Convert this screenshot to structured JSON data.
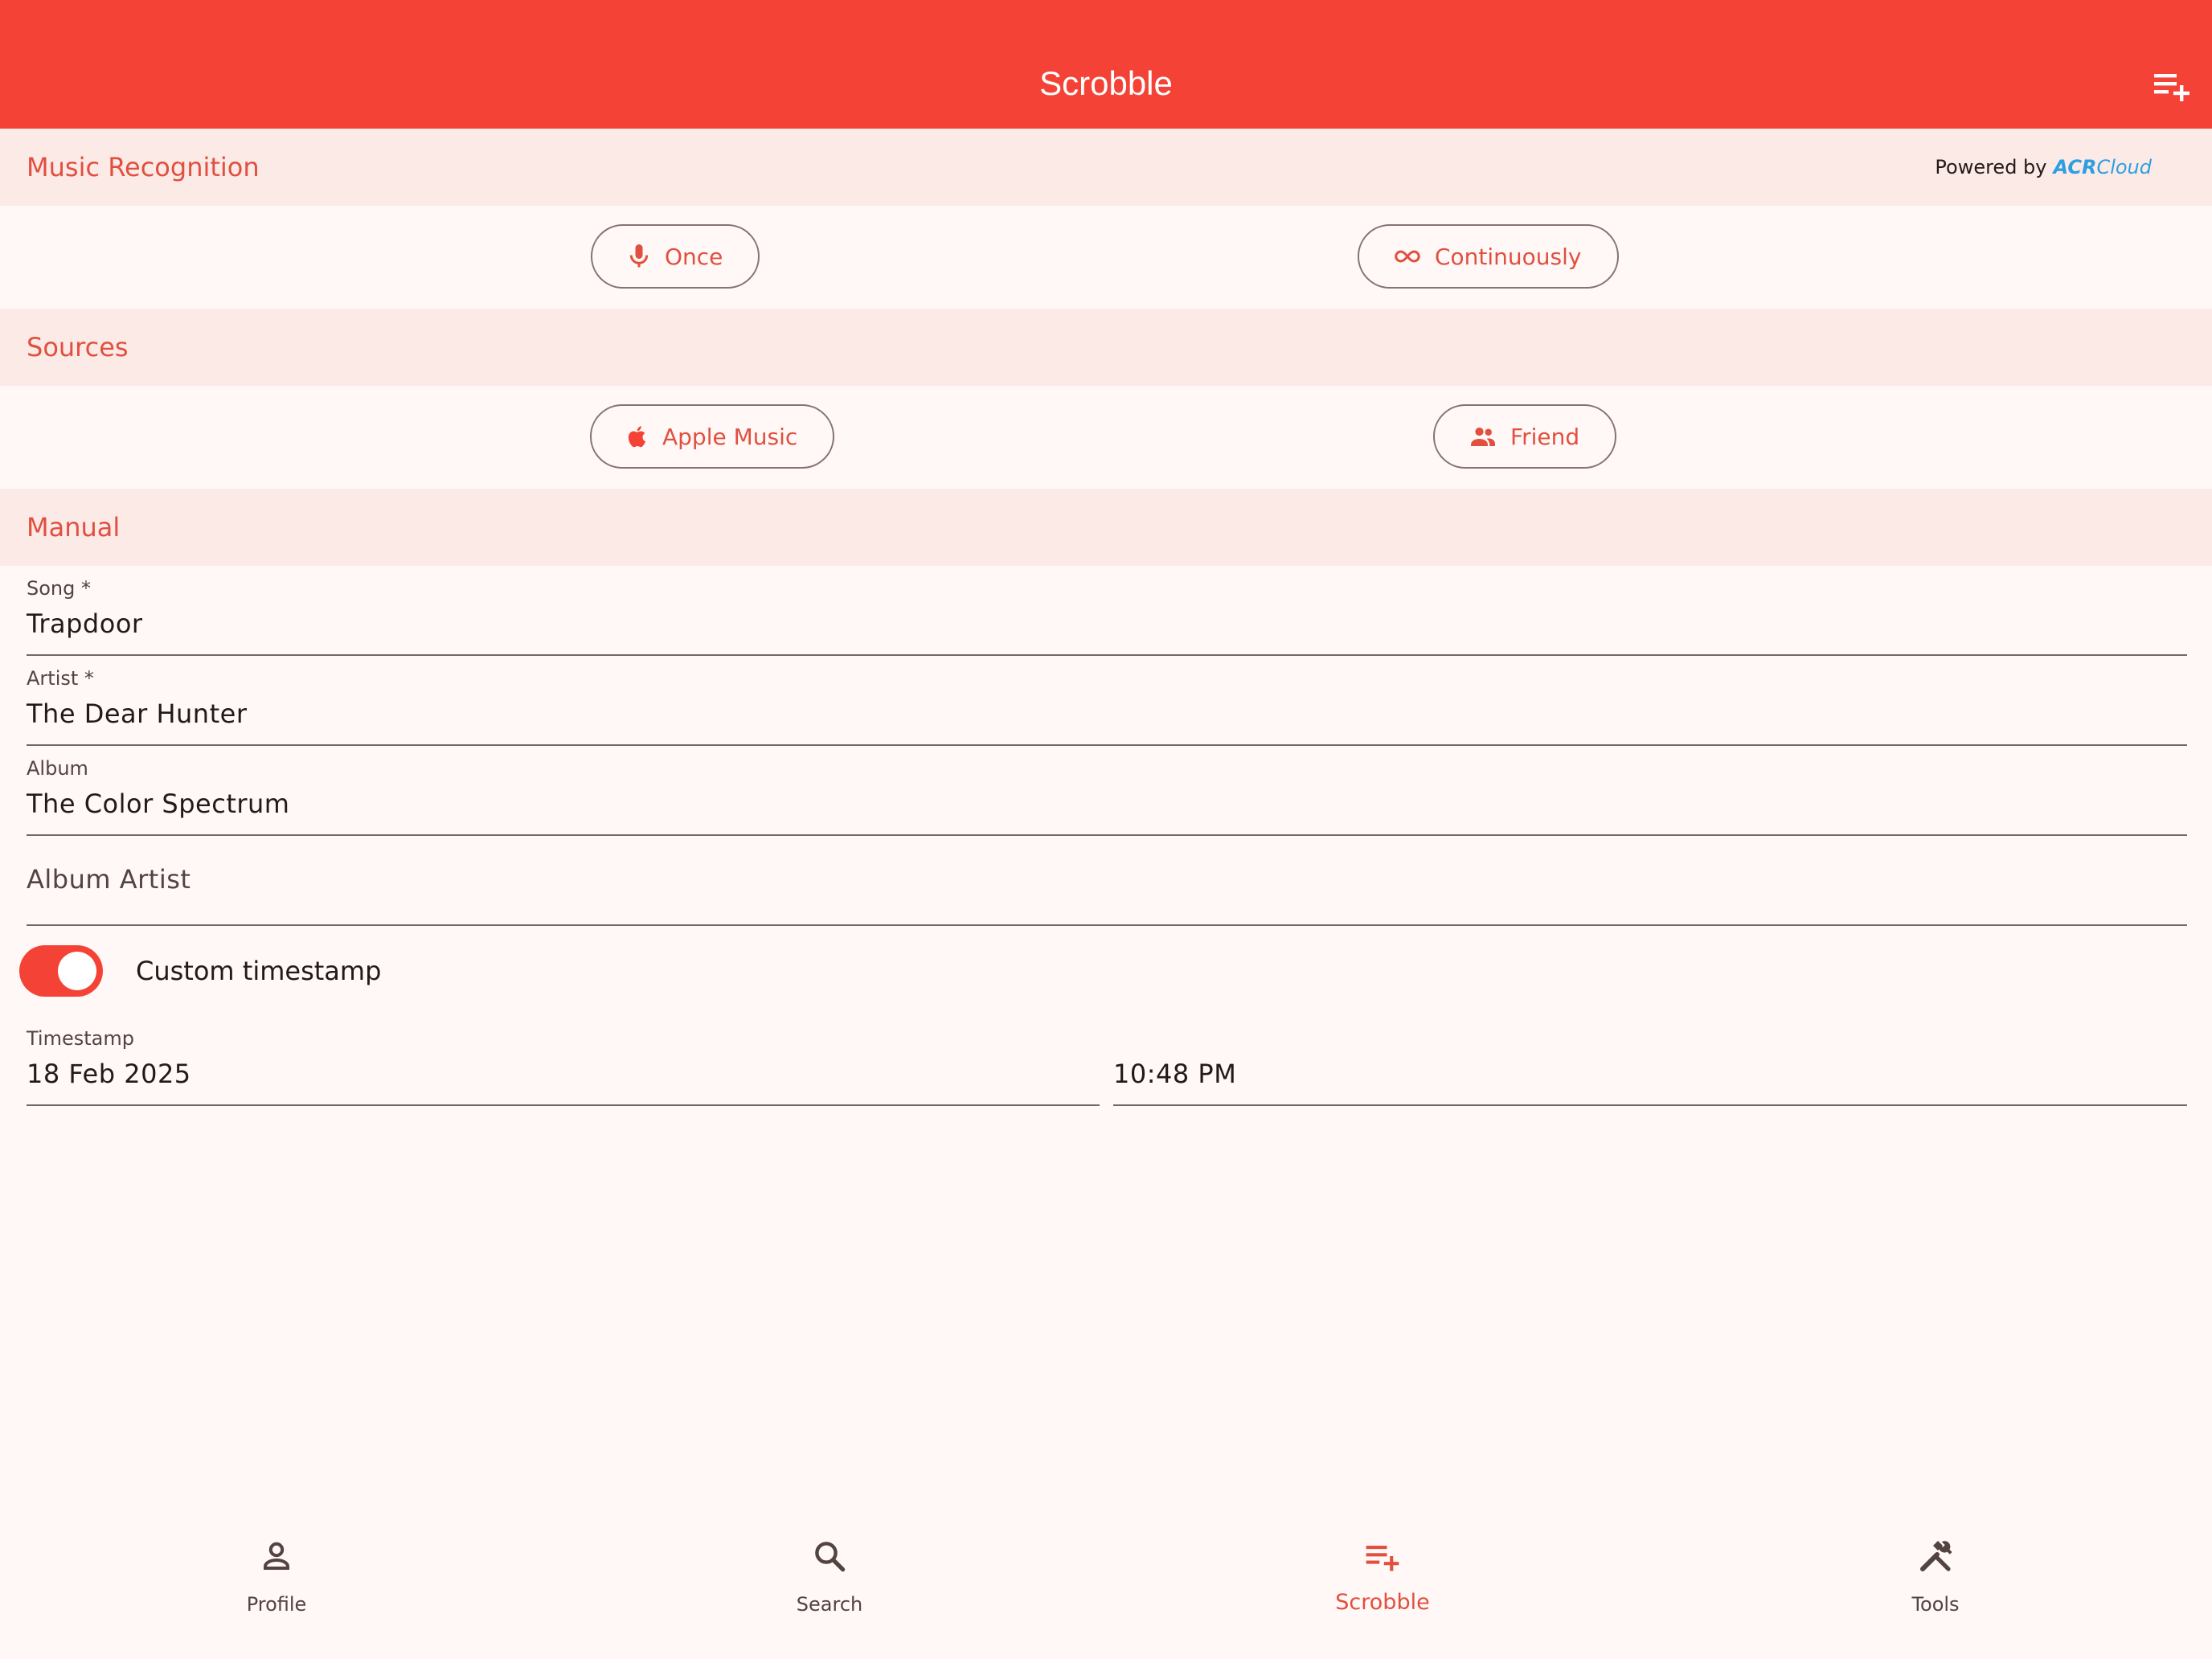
{
  "appbar": {
    "title": "Scrobble",
    "action_icon": "playlist-add-icon"
  },
  "recognition": {
    "section_title": "Music Recognition",
    "powered_by": "Powered by",
    "brand_strong": "ACR",
    "brand_light": "Cloud",
    "buttons": [
      {
        "label": "Once",
        "icon": "mic-icon"
      },
      {
        "label": "Continuously",
        "icon": "infinity-icon"
      }
    ]
  },
  "sources": {
    "section_title": "Sources",
    "buttons": [
      {
        "label": "Apple Music",
        "icon": "apple-icon"
      },
      {
        "label": "Friend",
        "icon": "people-icon"
      }
    ]
  },
  "manual": {
    "section_title": "Manual",
    "fields": {
      "song": {
        "label": "Song *",
        "value": "Trapdoor"
      },
      "artist": {
        "label": "Artist *",
        "value": "The Dear Hunter"
      },
      "album": {
        "label": "Album",
        "value": "The Color Spectrum"
      },
      "album_artist": {
        "placeholder": "Album Artist",
        "value": ""
      }
    },
    "custom_timestamp": {
      "label": "Custom timestamp",
      "enabled": true
    },
    "timestamp": {
      "label": "Timestamp",
      "date": "18 Feb 2025",
      "time": "10:48 PM"
    }
  },
  "bottom_nav": {
    "items": [
      {
        "label": "Profile",
        "icon": "person-icon",
        "active": false
      },
      {
        "label": "Search",
        "icon": "search-icon",
        "active": false
      },
      {
        "label": "Scrobble",
        "icon": "playlist-add-icon",
        "active": true
      },
      {
        "label": "Tools",
        "icon": "tools-icon",
        "active": false
      }
    ]
  },
  "colors": {
    "primary": "#F44336",
    "accent_text": "#E14F3F",
    "section_bg": "#FCEAE7",
    "background": "#FFF8F6",
    "brand": "#2C9FE0"
  }
}
